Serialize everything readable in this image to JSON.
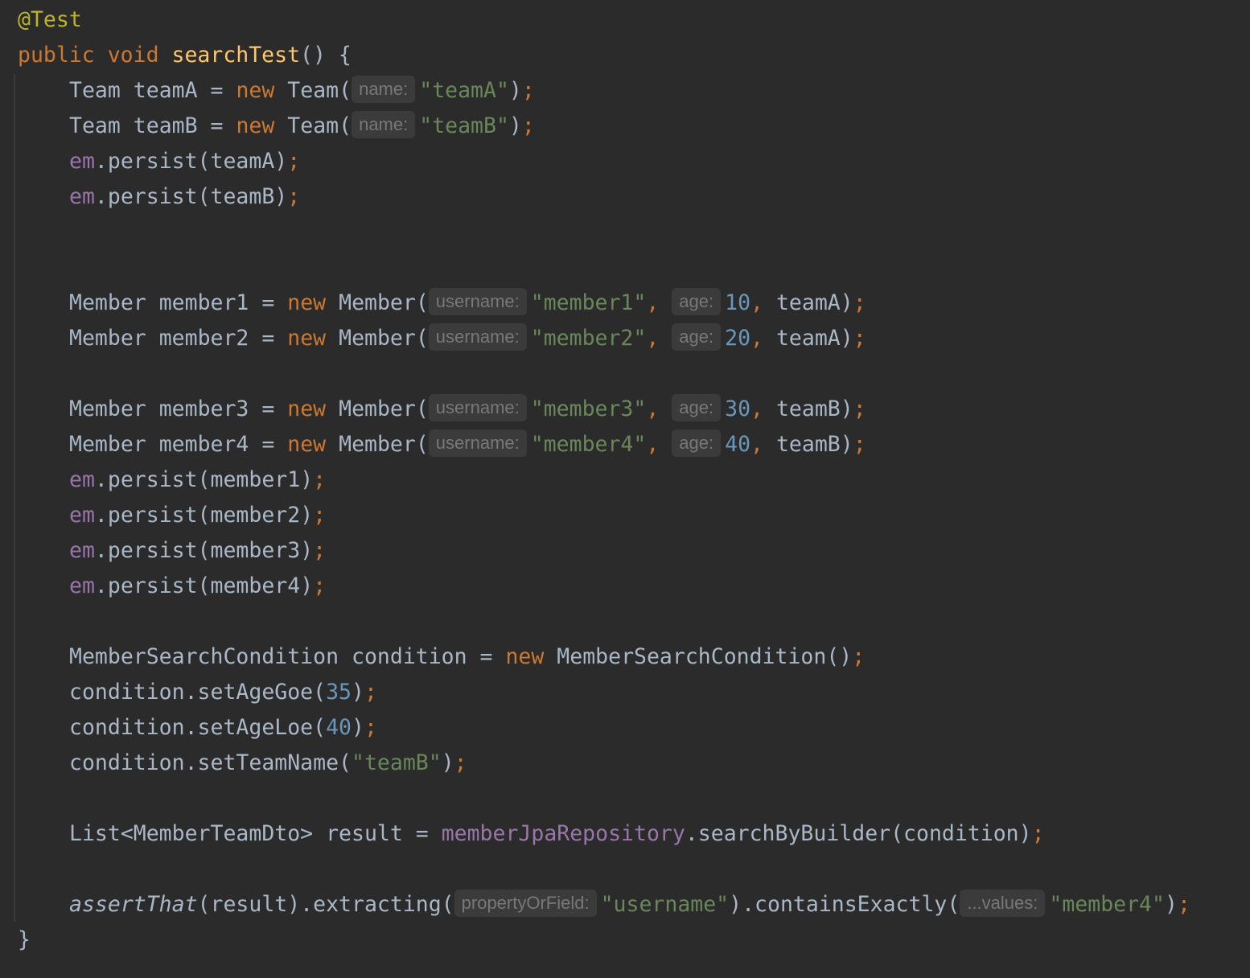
{
  "code": {
    "annotation": "@Test",
    "method_sig": {
      "kw_public": "public",
      "kw_void": "void",
      "name": "searchTest",
      "rest": "() {"
    },
    "team_a": {
      "type": "Team",
      "var": "teamA",
      "eq": " = ",
      "kw_new": "new",
      "ctor": "Team(",
      "hint": "name:",
      "arg": "\"teamA\"",
      "close": ")",
      "semi": ";"
    },
    "team_b": {
      "type": "Team",
      "var": "teamB",
      "eq": " = ",
      "kw_new": "new",
      "ctor": "Team(",
      "hint": "name:",
      "arg": "\"teamB\"",
      "close": ")",
      "semi": ";"
    },
    "persist_team_a": {
      "field": "em",
      "call": ".persist(teamA)",
      "semi": ";"
    },
    "persist_team_b": {
      "field": "em",
      "call": ".persist(teamB)",
      "semi": ";"
    },
    "members": [
      {
        "type": "Member",
        "var": "member1",
        "ctor": "Member(",
        "hint_username": "username:",
        "username": "\"member1\"",
        "hint_age": "age:",
        "age": "10",
        "team": "teamA"
      },
      {
        "type": "Member",
        "var": "member2",
        "ctor": "Member(",
        "hint_username": "username:",
        "username": "\"member2\"",
        "hint_age": "age:",
        "age": "20",
        "team": "teamA"
      },
      {
        "type": "Member",
        "var": "member3",
        "ctor": "Member(",
        "hint_username": "username:",
        "username": "\"member3\"",
        "hint_age": "age:",
        "age": "30",
        "team": "teamB"
      },
      {
        "type": "Member",
        "var": "member4",
        "ctor": "Member(",
        "hint_username": "username:",
        "username": "\"member4\"",
        "hint_age": "age:",
        "age": "40",
        "team": "teamB"
      }
    ],
    "kw_new": "new",
    "persists": [
      {
        "field": "em",
        "call": ".persist(member1)"
      },
      {
        "field": "em",
        "call": ".persist(member2)"
      },
      {
        "field": "em",
        "call": ".persist(member3)"
      },
      {
        "field": "em",
        "call": ".persist(member4)"
      }
    ],
    "condition_decl": {
      "text": "MemberSearchCondition condition = ",
      "kw_new": "new",
      "ctor": "MemberSearchCondition()"
    },
    "set_age_goe": {
      "call": "condition.setAgeGoe(",
      "num": "35"
    },
    "set_age_loe": {
      "call": "condition.setAgeLoe(",
      "num": "40"
    },
    "set_team_name": {
      "call": "condition.setTeamName(",
      "str": "\"teamB\""
    },
    "result_decl": {
      "text": "List<MemberTeamDto> result = ",
      "field": "memberJpaRepository",
      "call": ".searchByBuilder(condition)"
    },
    "assert_line": {
      "fn": "assertThat",
      "call1": "(result).extracting(",
      "hint_prop": "propertyOrField:",
      "str_prop": "\"username\"",
      "call2": ").containsExactly(",
      "hint_values": "...values:",
      "str_value": "\"member4\"",
      "close": ")"
    },
    "closing_brace": "}",
    "semicolon": ";",
    "comma": ",",
    "close_paren": ")"
  }
}
